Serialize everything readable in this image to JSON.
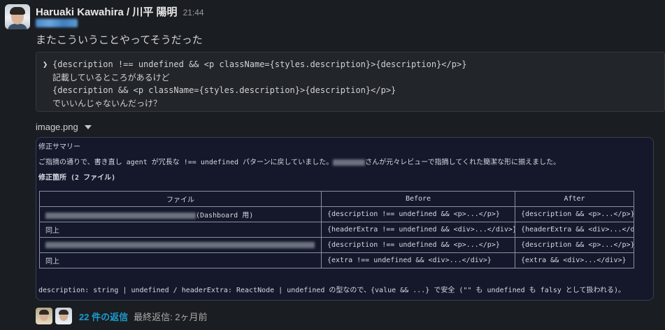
{
  "message": {
    "author": "Haruaki Kawahira / 川平 陽明",
    "time": "21:44",
    "text": "またこういうことやってそうだった"
  },
  "quote": {
    "lines": [
      "{description !== undefined && <p className={styles.description}>{description}</p>}",
      "記載しているところがあるけど",
      "{description && <p className={styles.description}>{description}</p>}",
      "でいいんじゃないんだっけ？"
    ]
  },
  "attachment": {
    "filename": "image.png",
    "toggle_icon": "caret-down-icon",
    "image": {
      "title": "修正サマリー",
      "intro_before": "ご指摘の通りで、書き直し agent が冗長な !== undefined パターンに戻していました。",
      "intro_after": "さんが元々レビューで指摘してくれた簡潔な形に揃えました。",
      "subheading": "修正箇所 (2 ファイル)",
      "table": {
        "headers": [
          "ファイル",
          "Before",
          "After"
        ],
        "rows": [
          {
            "file": "(Dashboard 用)",
            "before": "{description !== undefined && <p>...</p>}",
            "after": "{description && <p>...</p>}"
          },
          {
            "file": "同上",
            "before": "{headerExtra !== undefined && <div>...</div>}",
            "after": "{headerExtra && <div>...</div>}"
          },
          {
            "file": "",
            "before": "{description !== undefined && <p>...</p>}",
            "after": "{description && <p>...</p>}"
          },
          {
            "file": "同上",
            "before": "{extra !== undefined && <div>...</div>}",
            "after": "{extra && <div>...</div>}"
          }
        ]
      },
      "footer": "description: string | undefined / headerExtra: ReactNode | undefined の型なので、{value && ...} で安全 (\"\" も undefined も falsy として扱われる)。"
    }
  },
  "thread": {
    "reply_count": "22 件の返信",
    "last_reply": "最終返信: 2ヶ月前"
  },
  "colors": {
    "background": "#1a1d21",
    "link": "#1d9bd1",
    "image_background": "#14182a"
  }
}
